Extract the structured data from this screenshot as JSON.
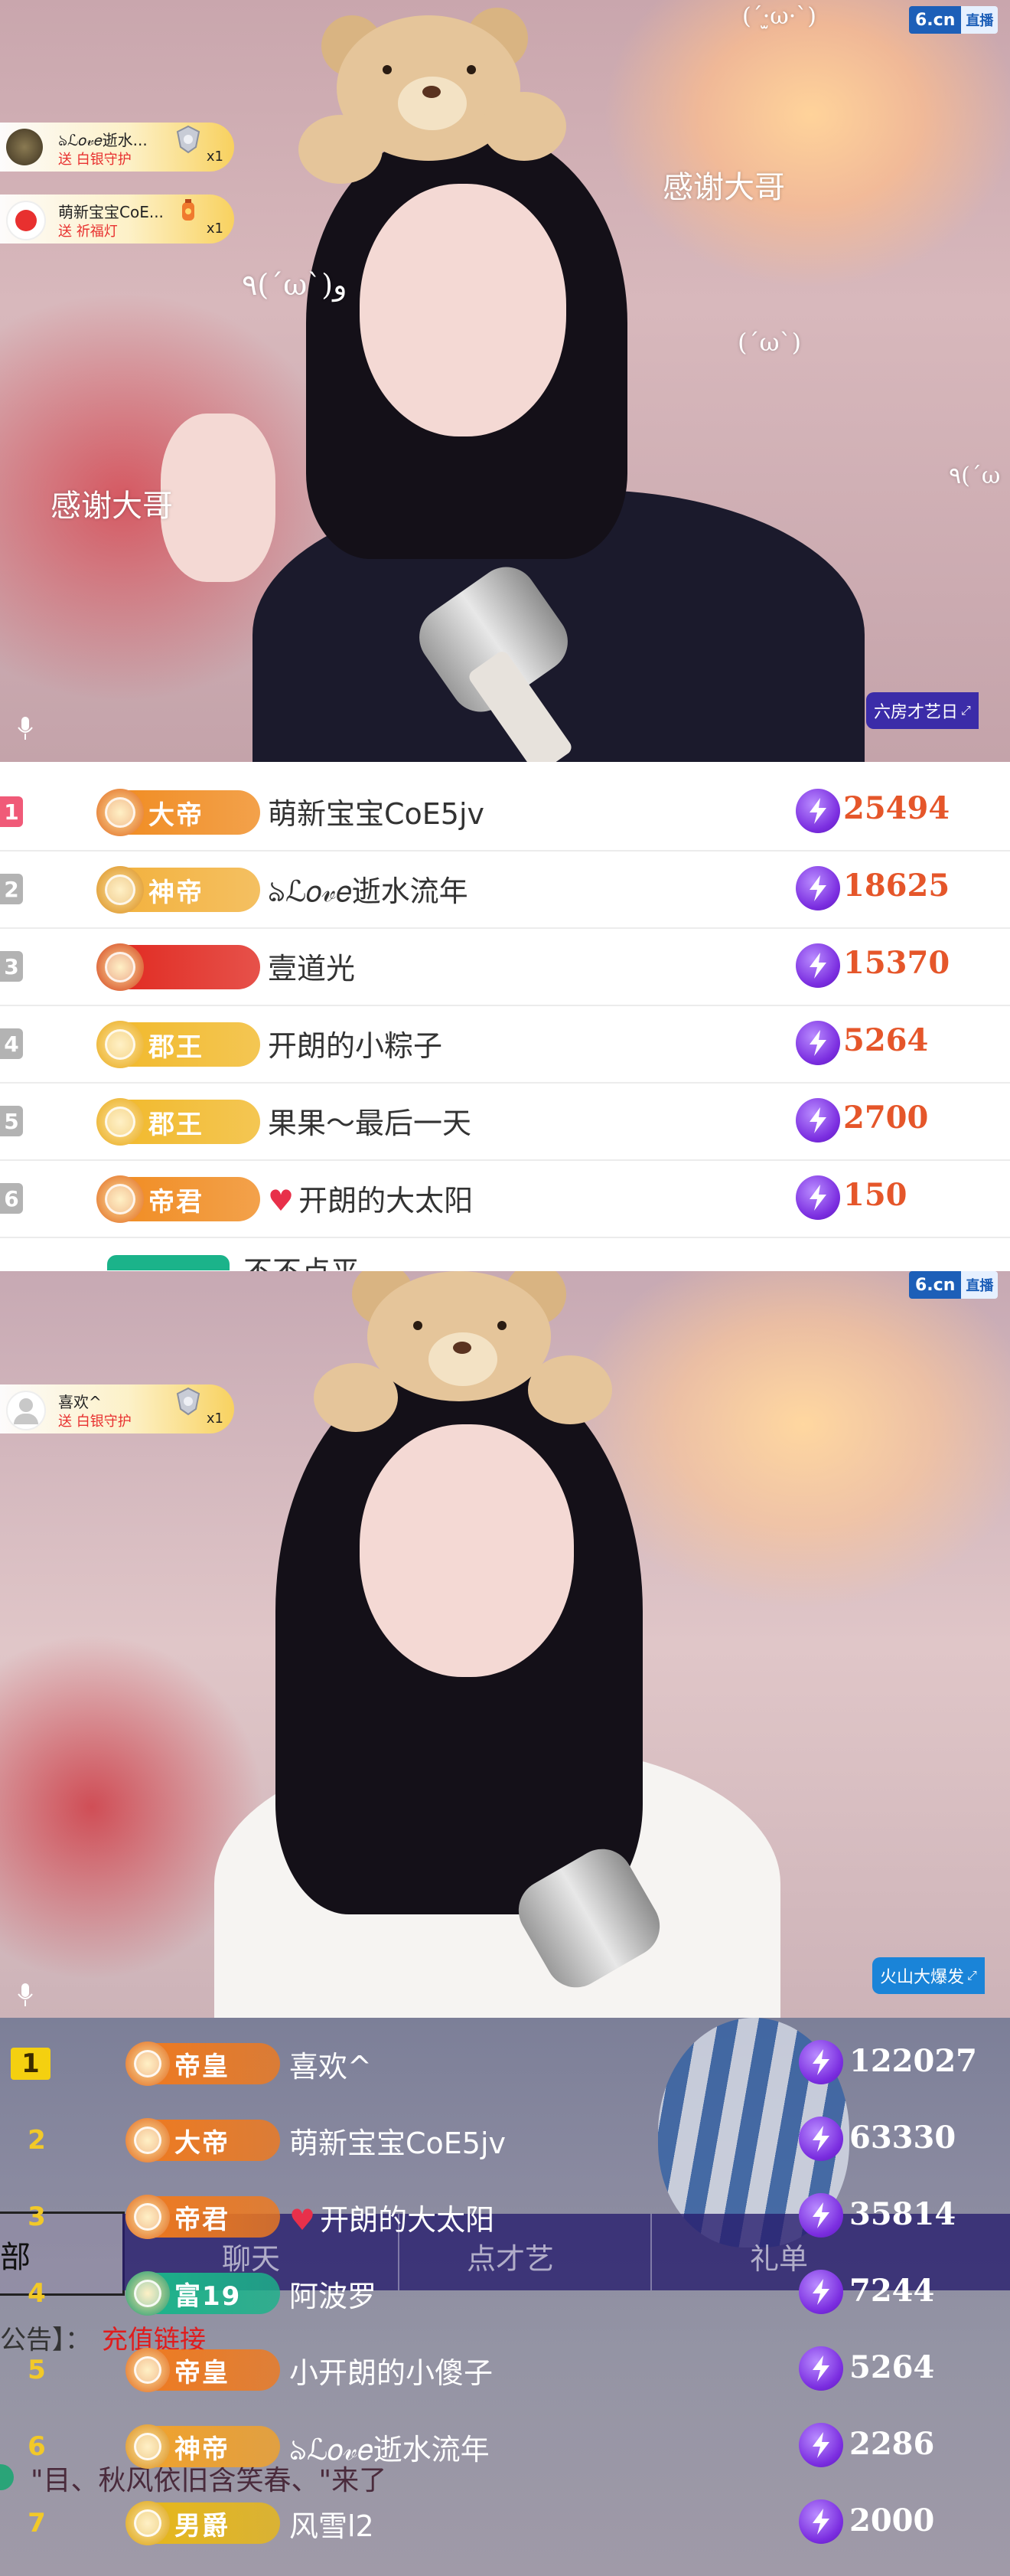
{
  "stream_top": {
    "platform_logo": "6.cn",
    "live_label": "直播",
    "gift_notifications": [
      {
        "user": "ঌℒ𝑜𝓋𝑒逝水...",
        "action": "送 白银守护",
        "count": "x1",
        "icon": "silver-guard-icon"
      },
      {
        "user": "萌新宝宝CoE...",
        "action": "送 祈福灯",
        "count": "x1",
        "icon": "lantern-icon"
      }
    ],
    "overlay_texts": [
      "(ˊ·̫ω·ˋ)",
      "感谢大哥",
      "٩(ˊωˋ)و",
      "(ˊωˋ)",
      "感谢大哥",
      "٩(ˊω"
    ],
    "room_tag": "六房才艺日"
  },
  "ranking_top": {
    "rows": [
      {
        "rank": "1",
        "badge": "大帝",
        "name": "萌新宝宝CoE5jv",
        "score": "25494",
        "rank_color": "#f05a78",
        "badge_color": "#f08a1e",
        "emblem_color": "#e0651a"
      },
      {
        "rank": "2",
        "badge": "神帝",
        "name": "ঌℒ𝑜𝓋𝑒逝水流年",
        "score": "18625",
        "rank_color": "#b3b3b3",
        "badge_color": "#f2b03a",
        "emblem_color": "#d98b1a"
      },
      {
        "rank": "3",
        "badge": "",
        "name": "壹道光",
        "score": "15370",
        "rank_color": "#b3b3b3",
        "badge_color": "#e0261d",
        "emblem_color": "#d23a16"
      },
      {
        "rank": "4",
        "badge": "郡王",
        "name": "开朗的小粽子",
        "score": "5264",
        "rank_color": "#b3b3b3",
        "badge_color": "#f1b828",
        "emblem_color": "#e8a818"
      },
      {
        "rank": "5",
        "badge": "郡王",
        "name": "果果～最后一天",
        "score": "2700",
        "rank_color": "#b3b3b3",
        "badge_color": "#f1b828",
        "emblem_color": "#e8a818"
      },
      {
        "rank": "6",
        "badge": "帝君",
        "name": "开朗的大太阳",
        "score": "150",
        "rank_color": "#b3b3b3",
        "badge_color": "#f08a1e",
        "emblem_color": "#e0651a",
        "heart": "♥"
      }
    ],
    "partial_row_name": "不不点平"
  },
  "stream_bottom": {
    "platform_logo": "6.cn",
    "live_label": "直播",
    "gift_notifications": [
      {
        "user": "喜欢^",
        "action": "送 白银守护",
        "count": "x1",
        "icon": "silver-guard-icon"
      }
    ],
    "room_tag": "火山大爆发"
  },
  "ranking_bottom": {
    "tabs": [
      "聊天",
      "点才艺",
      "礼单"
    ],
    "side_label": "部",
    "notice_label": "公告】：",
    "notice_link": "充值链接",
    "ghost_chat": "\"目、秋风依旧含笑春、\"来了",
    "rows": [
      {
        "rank": "1",
        "badge": "帝皇",
        "name": "喜欢^",
        "score": "122027",
        "badge_color": "#f07a1e",
        "emblem_color": "#e0651a"
      },
      {
        "rank": "2",
        "badge": "大帝",
        "name": "萌新宝宝CoE5jv",
        "score": "63330",
        "badge_color": "#f07a1e",
        "emblem_color": "#e0651a"
      },
      {
        "rank": "3",
        "badge": "帝君",
        "name": "开朗的大太阳",
        "score": "35814",
        "badge_color": "#f07a1e",
        "emblem_color": "#e0651a",
        "heart": "♥"
      },
      {
        "rank": "4",
        "badge": "富19",
        "name": "阿波罗",
        "score": "7244",
        "badge_color": "#1bb38a",
        "emblem_color": "#14986f"
      },
      {
        "rank": "5",
        "badge": "帝皇",
        "name": "小开朗的小傻子",
        "score": "5264",
        "badge_color": "#f07a1e",
        "emblem_color": "#e0651a"
      },
      {
        "rank": "6",
        "badge": "神帝",
        "name": "ঌℒ𝑜𝓋𝑒逝水流年",
        "score": "2286",
        "badge_color": "#f2a22a",
        "emblem_color": "#d98b1a"
      },
      {
        "rank": "7",
        "badge": "男爵",
        "name": "风雪l2",
        "score": "2000",
        "badge_color": "#e8b818",
        "emblem_color": "#d9a010"
      }
    ]
  }
}
